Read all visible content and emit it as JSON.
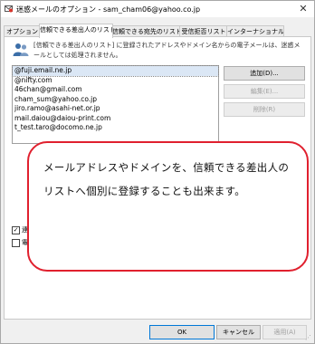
{
  "window": {
    "title": "迷惑メールのオプション - sam_cham06@yahoo.co.jp",
    "close_glyph": "✕"
  },
  "tabs": [
    {
      "label": "オプション",
      "active": false
    },
    {
      "label": "信頼できる差出人のリスト",
      "active": true
    },
    {
      "label": "信頼できる宛先のリスト",
      "active": false
    },
    {
      "label": "受信拒否リスト",
      "active": false
    },
    {
      "label": "インターナショナル",
      "active": false
    }
  ],
  "panel": {
    "description": "[信頼できる差出人のリスト] に登録されたアドレスやドメイン名からの電子メールは、迷惑メールとしては処理されません。",
    "list": [
      "@fuji.email.ne.jp",
      "@nifty.com",
      "46chan@gmail.com",
      "cham_sum@yahoo.co.jp",
      "jiro.ramo@asahi-net.or.jp",
      "mail.daiou@daiou-print.com",
      "t_test.taro@docomo.ne.jp"
    ],
    "buttons": {
      "add": "追加(D)...",
      "edit": "編集(E)...",
      "delete": "削除(R)"
    },
    "side_buttons": {
      "import": "...",
      "export": "..."
    },
    "checkboxes": [
      {
        "label": "連",
        "checked": true
      },
      {
        "label": "電",
        "checked": false
      }
    ]
  },
  "callout": {
    "text": "メールアドレスやドメインを、信頼できる差出人のリストへ個別に登録することも出来ます。"
  },
  "footer": {
    "ok": "OK",
    "cancel": "キャンセル",
    "apply": "適用(A)"
  }
}
